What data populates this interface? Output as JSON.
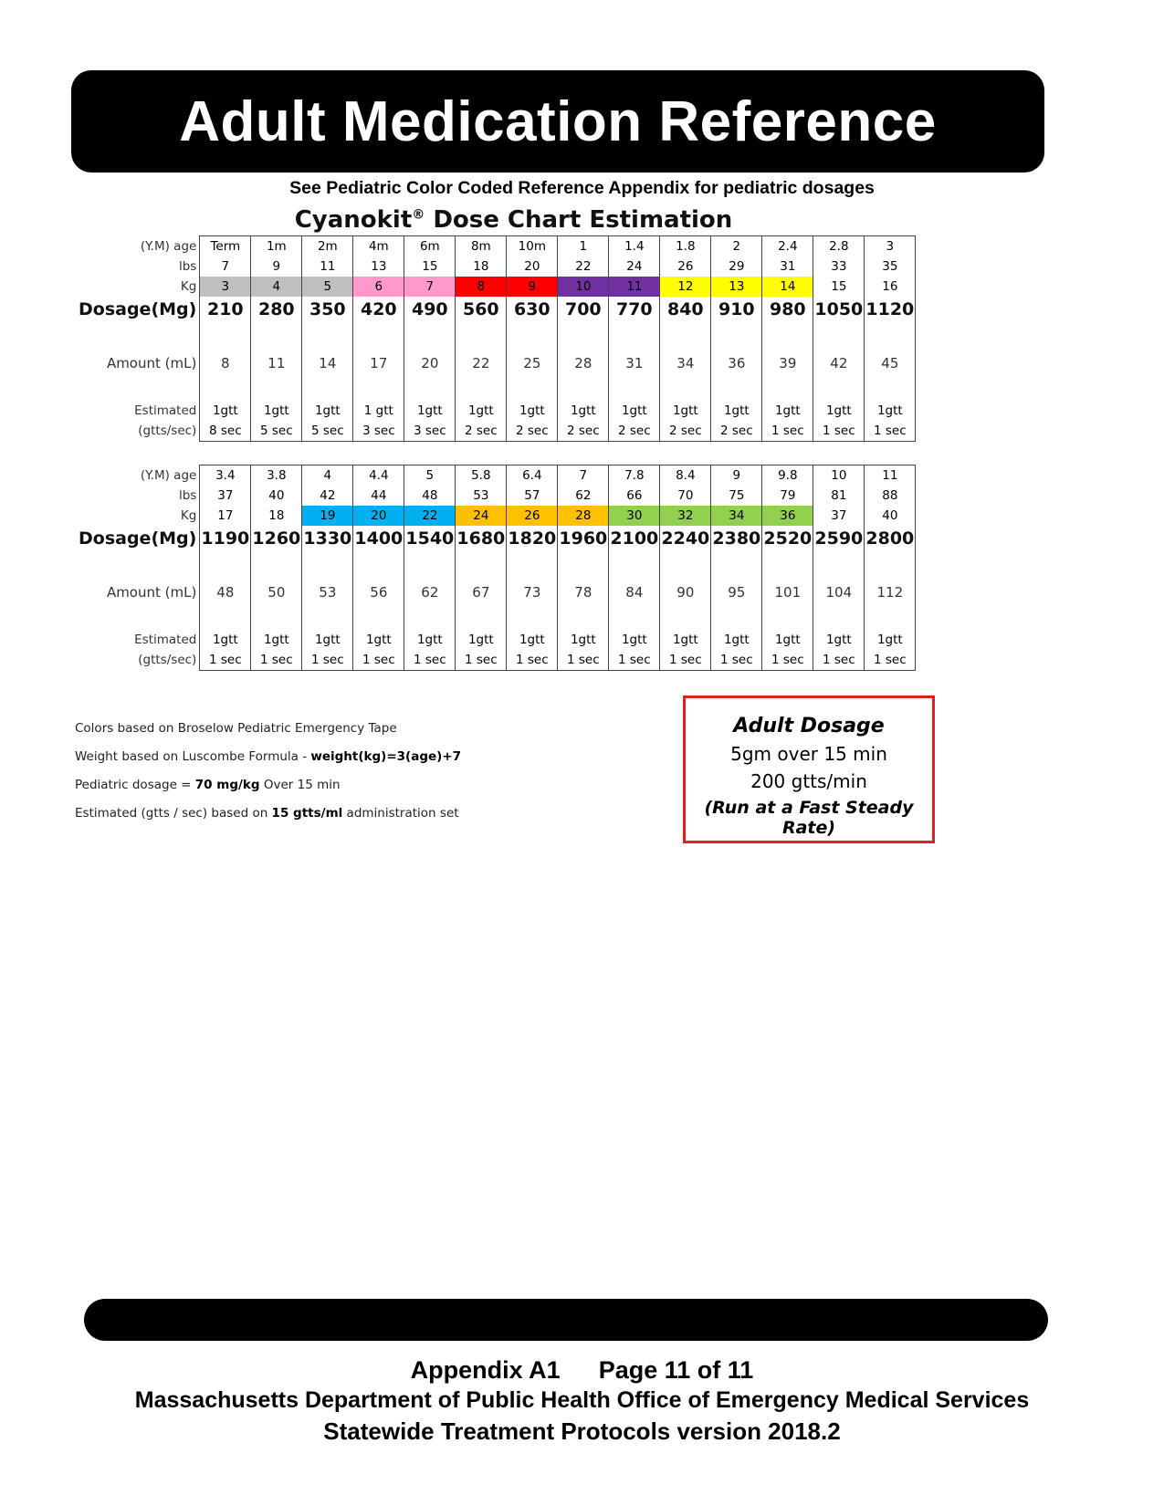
{
  "header": {
    "title": "Adult Medication Reference"
  },
  "subtitle": "See Pediatric Color Coded Reference Appendix for pediatric dosages",
  "chart_title": "Cyanokit",
  "chart_title_mark": "®",
  "chart_title_rest": " Dose Chart Estimation",
  "row_labels": {
    "age": "(Y.M) age",
    "lbs": "lbs",
    "kg": "Kg",
    "dosage": "Dosage(Mg)",
    "amount": "Amount (mL)",
    "est1": "Estimated",
    "est2": "(gtts/sec)"
  },
  "colors": {
    "grey": "#bfbfbf",
    "pink": "#ff99cc",
    "red": "#ff0000",
    "purple": "#7030a0",
    "yellow": "#ffff00",
    "blue": "#00b0f0",
    "orange": "#ffc000",
    "green": "#92d050",
    "border_red": "#e01f1f"
  },
  "tables": [
    {
      "age": [
        "Term",
        "1m",
        "2m",
        "4m",
        "6m",
        "8m",
        "10m",
        "1",
        "1.4",
        "1.8",
        "2",
        "2.4",
        "2.8",
        "3"
      ],
      "lbs": [
        "7",
        "9",
        "11",
        "13",
        "15",
        "18",
        "20",
        "22",
        "24",
        "26",
        "29",
        "31",
        "33",
        "35"
      ],
      "kg": [
        "3",
        "4",
        "5",
        "6",
        "7",
        "8",
        "9",
        "10",
        "11",
        "12",
        "13",
        "14",
        "15",
        "16"
      ],
      "kg_color": [
        "grey",
        "grey",
        "grey",
        "pink",
        "pink",
        "red",
        "red",
        "purple",
        "purple",
        "yellow",
        "yellow",
        "yellow",
        "",
        ""
      ],
      "dosage": [
        "210",
        "280",
        "350",
        "420",
        "490",
        "560",
        "630",
        "700",
        "770",
        "840",
        "910",
        "980",
        "1050",
        "1120"
      ],
      "amount": [
        "8",
        "11",
        "14",
        "17",
        "20",
        "22",
        "25",
        "28",
        "31",
        "34",
        "36",
        "39",
        "42",
        "45"
      ],
      "gtt": [
        "1gtt",
        "1gtt",
        "1gtt",
        "1 gtt",
        "1gtt",
        "1gtt",
        "1gtt",
        "1gtt",
        "1gtt",
        "1gtt",
        "1gtt",
        "1gtt",
        "1gtt",
        "1gtt"
      ],
      "sec": [
        "8 sec",
        "5 sec",
        "5 sec",
        "3 sec",
        "3 sec",
        "2 sec",
        "2 sec",
        "2 sec",
        "2 sec",
        "2 sec",
        "2 sec",
        "1 sec",
        "1 sec",
        "1 sec"
      ]
    },
    {
      "age": [
        "3.4",
        "3.8",
        "4",
        "4.4",
        "5",
        "5.8",
        "6.4",
        "7",
        "7.8",
        "8.4",
        "9",
        "9.8",
        "10",
        "11"
      ],
      "lbs": [
        "37",
        "40",
        "42",
        "44",
        "48",
        "53",
        "57",
        "62",
        "66",
        "70",
        "75",
        "79",
        "81",
        "88"
      ],
      "kg": [
        "17",
        "18",
        "19",
        "20",
        "22",
        "24",
        "26",
        "28",
        "30",
        "32",
        "34",
        "36",
        "37",
        "40"
      ],
      "kg_color": [
        "",
        "",
        "blue",
        "blue",
        "blue",
        "orange",
        "orange",
        "orange",
        "green",
        "green",
        "green",
        "green",
        "",
        ""
      ],
      "dosage": [
        "1190",
        "1260",
        "1330",
        "1400",
        "1540",
        "1680",
        "1820",
        "1960",
        "2100",
        "2240",
        "2380",
        "2520",
        "2590",
        "2800"
      ],
      "amount": [
        "48",
        "50",
        "53",
        "56",
        "62",
        "67",
        "73",
        "78",
        "84",
        "90",
        "95",
        "101",
        "104",
        "112"
      ],
      "gtt": [
        "1gtt",
        "1gtt",
        "1gtt",
        "1gtt",
        "1gtt",
        "1gtt",
        "1gtt",
        "1gtt",
        "1gtt",
        "1gtt",
        "1gtt",
        "1gtt",
        "1gtt",
        "1gtt"
      ],
      "sec": [
        "1 sec",
        "1 sec",
        "1 sec",
        "1 sec",
        "1 sec",
        "1 sec",
        "1 sec",
        "1 sec",
        "1 sec",
        "1 sec",
        "1 sec",
        "1 sec",
        "1 sec",
        "1 sec"
      ]
    }
  ],
  "notes": {
    "n1": "Colors based on Broselow Pediatric Emergency Tape",
    "n2_a": "Weight based on Luscombe Formula - ",
    "n2_b": "weight(kg)=3(age)+7",
    "n3_a": "Pediatric dosage = ",
    "n3_b": "70 mg/kg",
    "n3_c": " Over 15 min",
    "n4_a": "Estimated  (gtts / sec) based on ",
    "n4_b": "15 gtts/ml",
    "n4_c": " administration set"
  },
  "adult_box": {
    "title": "Adult Dosage",
    "line1": "5gm over 15 min",
    "line2": "200 gtts/min",
    "line3": "(Run at a Fast Steady Rate)"
  },
  "footer": {
    "appendix": "Appendix A1",
    "page": "Page 11 of 11",
    "dept": "Massachusetts Department of Public Health Office of Emergency Medical Services",
    "version": "Statewide Treatment Protocols version 2018.2"
  }
}
